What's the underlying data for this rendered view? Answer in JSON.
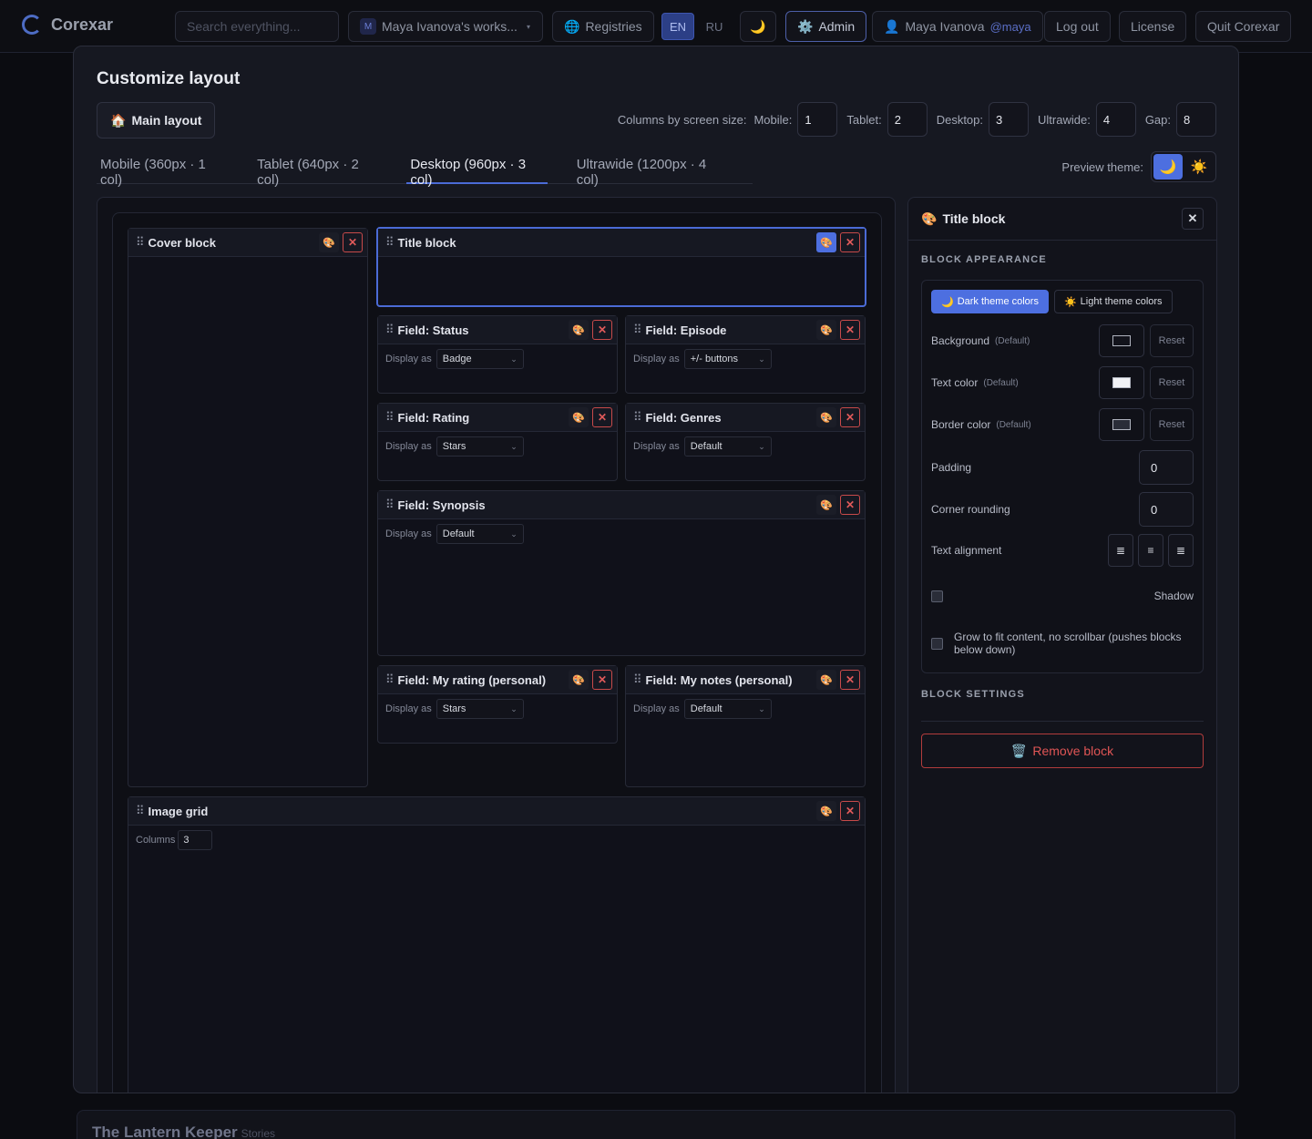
{
  "app": {
    "name": "Corexar"
  },
  "topbar": {
    "search_placeholder": "Search everything...",
    "workspace": {
      "initial": "M",
      "label": "Maya Ivanova's works..."
    },
    "registries": "Registries",
    "lang_en": "EN",
    "lang_ru": "RU",
    "admin": "Admin",
    "user_name": "Maya Ivanova",
    "user_handle": "@maya",
    "logout": "Log out",
    "license": "License",
    "quit": "Quit Corexar"
  },
  "modal": {
    "title": "Customize layout",
    "main_layout": "Main layout",
    "columns_label": "Columns by screen size:",
    "sizes": [
      {
        "label": "Mobile:",
        "value": "1"
      },
      {
        "label": "Tablet:",
        "value": "2"
      },
      {
        "label": "Desktop:",
        "value": "3"
      },
      {
        "label": "Ultrawide:",
        "value": "4"
      },
      {
        "label": "Gap:",
        "value": "8"
      }
    ],
    "tabs": [
      {
        "label": "Mobile (360px · 1 col)"
      },
      {
        "label": "Tablet (640px · 2 col)"
      },
      {
        "label": "Desktop (960px · 3 col)",
        "active": true
      },
      {
        "label": "Ultrawide (1200px · 4 col)"
      }
    ],
    "preview_theme_label": "Preview theme:"
  },
  "blocks": {
    "display_as": "Display as",
    "cover": {
      "title": "Cover block"
    },
    "title": {
      "title": "Title block"
    },
    "status": {
      "title": "Field: Status",
      "value": "Badge"
    },
    "episode": {
      "title": "Field: Episode",
      "value": "+/- buttons"
    },
    "rating": {
      "title": "Field: Rating",
      "value": "Stars"
    },
    "genres": {
      "title": "Field: Genres",
      "value": "Default"
    },
    "synopsis": {
      "title": "Field: Synopsis",
      "value": "Default"
    },
    "my_rating": {
      "title": "Field: My rating (personal)",
      "value": "Stars"
    },
    "my_notes": {
      "title": "Field: My notes (personal)",
      "value": "Default"
    },
    "image_grid": {
      "title": "Image grid",
      "columns_label": "Columns",
      "columns_value": "3"
    }
  },
  "panel": {
    "title": "Title block",
    "appearance_title": "BLOCK APPEARANCE",
    "dark_tab": "Dark theme colors",
    "light_tab": "Light theme colors",
    "background": "Background",
    "text_color": "Text color",
    "border_color": "Border color",
    "default_tag": "(Default)",
    "reset": "Reset",
    "padding": "Padding",
    "padding_value": "0",
    "corner_rounding": "Corner rounding",
    "corner_value": "0",
    "text_alignment": "Text alignment",
    "shadow": "Shadow",
    "grow": "Grow to fit content, no scrollbar (pushes blocks below down)",
    "settings_title": "BLOCK SETTINGS",
    "remove": "Remove block"
  },
  "story": {
    "title": "The Lantern Keeper",
    "subtitle": "Stories"
  },
  "colors": {
    "accent": "#4d6fe0",
    "danger": "#e05555",
    "background": "#0b0c11",
    "surface": "#161821"
  }
}
